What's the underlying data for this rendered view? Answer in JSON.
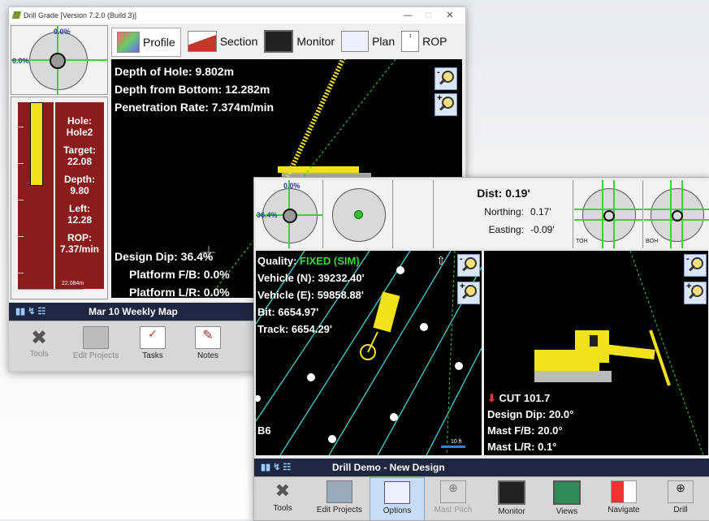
{
  "win1": {
    "title": "Drill Grade [Version 7.2.0 (Build 3)]",
    "gauge_top": "0.0%",
    "gauge_left": "0.0%",
    "tabs": [
      {
        "label": "Profile",
        "icon": "profile-icon"
      },
      {
        "label": "Section",
        "icon": "section-icon"
      },
      {
        "label": "Monitor",
        "icon": "monitor-icon"
      },
      {
        "label": "Plan",
        "icon": "plan-icon"
      },
      {
        "label": "ROP",
        "icon": "rop-icon"
      }
    ],
    "info": {
      "depth_of_hole": "Depth of Hole: 9.802m",
      "depth_from_bottom": "Depth from Bottom: 12.282m",
      "penetration_rate": "Penetration Rate: 7.374m/min",
      "design_dip": "Design Dip: 36.4%",
      "platform_fb": "Platform F/B: 0.0%",
      "platform_lr": "Platform L/R: 0.0%"
    },
    "side": {
      "hole_label": "Hole:",
      "hole_value": "Hole2",
      "target_label": "Target:",
      "target_value": "22.08",
      "depth_label": "Depth:",
      "depth_value": "9.80",
      "left_label": "Left:",
      "left_value": "12.28",
      "rop_label": "ROP:",
      "rop_value": "7.37/min",
      "scale_bottom": "22.084m",
      "fill_fraction": 0.44
    },
    "status": "Mar 10 Weekly Map",
    "toolbar": [
      {
        "label": "Tools",
        "icon": "wrench-icon"
      },
      {
        "label": "Edit Projects",
        "icon": "edit-projects-icon"
      },
      {
        "label": "Tasks",
        "icon": "tasks-icon"
      },
      {
        "label": "Notes",
        "icon": "notes-icon"
      }
    ]
  },
  "win2": {
    "gauge_top": "0.0%",
    "gauge_left": "36.4%",
    "dist_label": "Dist:",
    "dist_value": "0.19'",
    "northing_label": "Northing:",
    "northing_value": "0.17'",
    "easting_label": "Easting:",
    "easting_value": "-0.09'",
    "toh_label": "TOH",
    "boh_label": "BOH",
    "plan": {
      "quality_label": "Quality:",
      "quality_value": "FIXED (SIM)",
      "vehicle_n": "Vehicle (N): 39232.40'",
      "vehicle_e": "Vehicle (E): 59858.88'",
      "bit": "Bit: 6654.97'",
      "track": "Track: 6654.29'",
      "row_label": "B6",
      "scale": "10 ft"
    },
    "profile": {
      "cut": "CUT 101.7",
      "design_dip": "Design Dip: 20.0°",
      "mast_fb": "Mast F/B: 20.0°",
      "mast_lr": "Mast L/R: 0.1°"
    },
    "status": "Drill Demo - New Design",
    "toolbar": [
      {
        "label": "Tools",
        "icon": "wrench-icon"
      },
      {
        "label": "Edit Projects",
        "icon": "edit-projects-icon"
      },
      {
        "label": "Options",
        "icon": "options-icon"
      },
      {
        "label": "Mast Pitch",
        "icon": "mast-pitch-icon"
      },
      {
        "label": "Monitor",
        "icon": "monitor-icon"
      },
      {
        "label": "Views",
        "icon": "views-icon"
      },
      {
        "label": "Navigate",
        "icon": "navigate-icon"
      },
      {
        "label": "Drill",
        "icon": "drill-icon"
      }
    ]
  },
  "colors": {
    "accent_green": "#39d439",
    "quality_green": "#3fd33f",
    "machine_yellow": "#f2e21a",
    "status_bar": "#1f2640",
    "depth_red": "#8a1c1c"
  }
}
